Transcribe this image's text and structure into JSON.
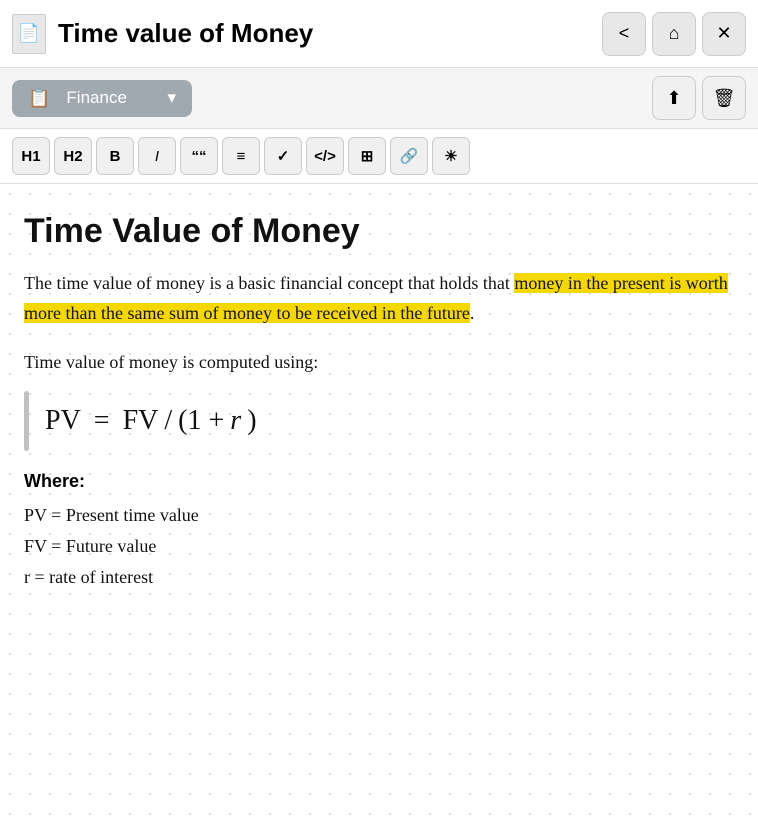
{
  "titleBar": {
    "title": "Time value of Money",
    "docIcon": "📄"
  },
  "controls": {
    "back": "<",
    "home": "⌂",
    "close": "✕"
  },
  "toolbar": {
    "category": "Finance",
    "categoryIcon": "📋",
    "dropdownArrow": "▾",
    "uploadIcon": "⬆",
    "deleteIcon": "🗑"
  },
  "formatBar": {
    "h1": "H1",
    "h2": "H2",
    "bold": "B",
    "italic": "I",
    "quote": "““",
    "list": "≡",
    "check": "✓",
    "code": "</>",
    "table": "⊞",
    "link": "🔗",
    "bulb": "☀"
  },
  "article": {
    "title": "Time Value of Money",
    "body1": "The time value of money is a basic financial concept that holds that ",
    "highlighted": "money in the present is worth more than the same sum of money to be received in the future",
    "body2": ".",
    "computedLabel": "Time value of money is computed using:",
    "formula": "PV = FV/(1 + r)",
    "formulaDisplay": {
      "pv": "PV",
      "equals": "=",
      "fv": "FV",
      "slash": "/",
      "lparen": "(1 + ",
      "r": "r",
      "rparen": ")"
    },
    "whereTitle": "Where:",
    "whereItems": [
      "PV = Present time value",
      "FV = Future value",
      "r = rate of interest"
    ]
  }
}
